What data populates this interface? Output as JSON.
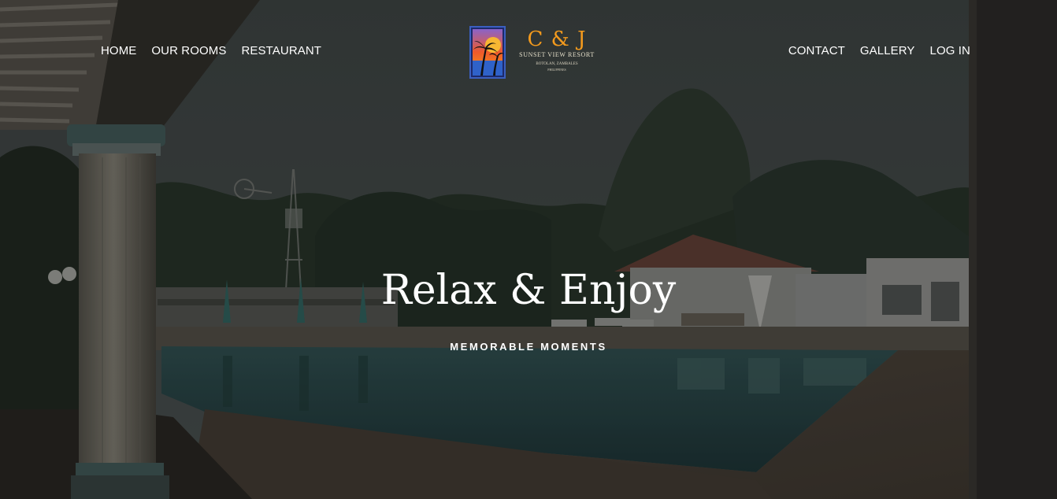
{
  "nav": {
    "left": [
      "HOME",
      "OUR ROOMS",
      "RESTAURANT"
    ],
    "right": [
      "CONTACT",
      "GALLERY",
      "LOG IN"
    ]
  },
  "logo": {
    "mark": "C & J",
    "name": "SUNSET VIEW RESORT",
    "location": "BOTOLAN, ZAMBALES",
    "country": "PHILIPPINES",
    "icon": "palm-tree-sunset-icon"
  },
  "hero": {
    "title": "Relax & Enjoy",
    "subtitle": "MEMORABLE MOMENTS",
    "background": "resort-pool-photo"
  },
  "colors": {
    "text": "#ffffff",
    "overlay": "#2b2d2c",
    "logo_orange": "#f39a1d",
    "logo_blue": "#3b5fc0",
    "logo_purple": "#8a63c9"
  }
}
